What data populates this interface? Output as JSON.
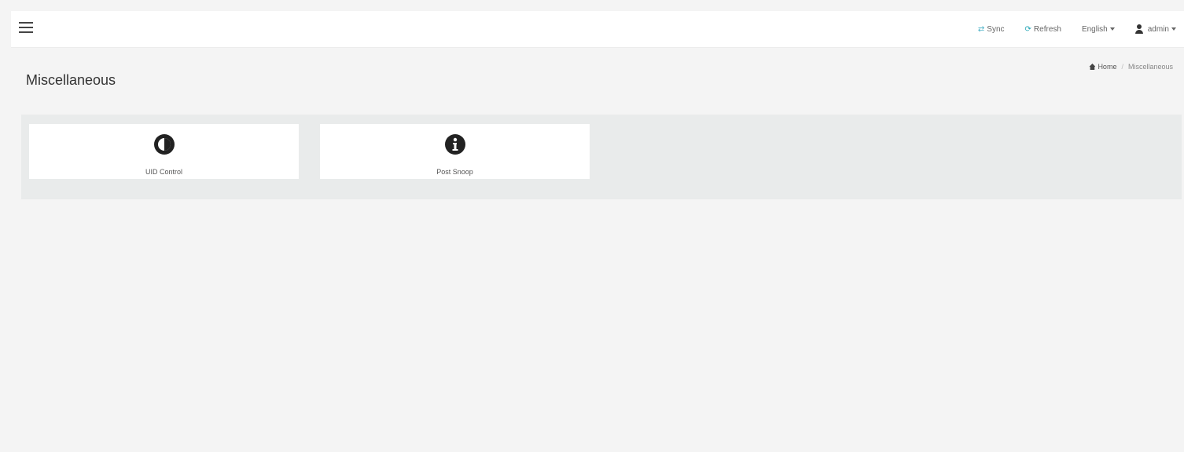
{
  "header": {
    "menu_icon": "hamburger-icon",
    "sync_label": "Sync",
    "refresh_label": "Refresh",
    "language_label": "English",
    "user_label": "admin"
  },
  "page": {
    "title": "Miscellaneous",
    "breadcrumb": {
      "home": "Home",
      "current": "Miscellaneous"
    }
  },
  "tiles": [
    {
      "label": "UID Control",
      "icon": "contrast-icon"
    },
    {
      "label": "Post Snoop",
      "icon": "info-circle-icon"
    }
  ]
}
